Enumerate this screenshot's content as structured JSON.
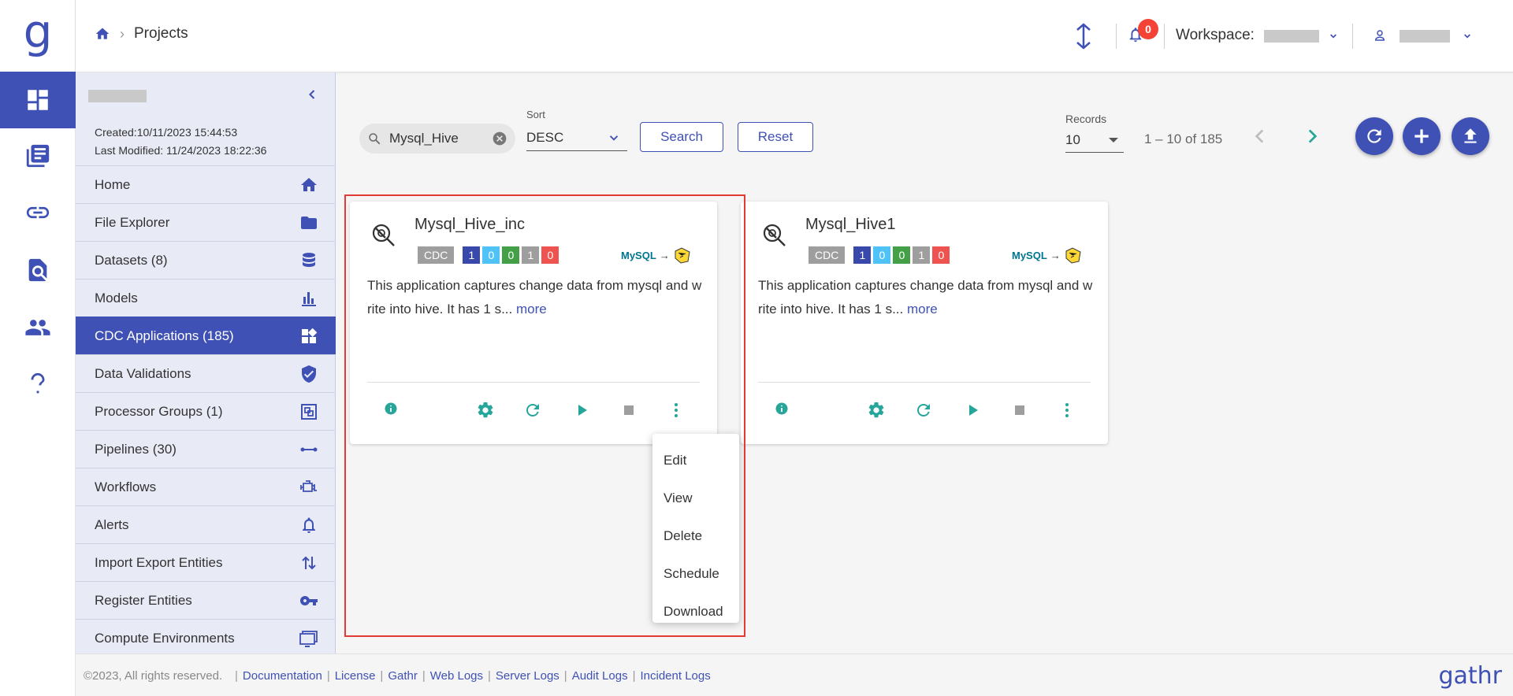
{
  "app": {
    "logo_letter": "g",
    "brand": "gathr"
  },
  "breadcrumb": {
    "current": "Projects"
  },
  "header": {
    "notification_count": "0",
    "workspace_label": "Workspace:"
  },
  "panel": {
    "created": "Created:10/11/2023 15:44:53",
    "modified": "Last Modified: 11/24/2023 18:22:36",
    "menu": [
      {
        "label": "Home",
        "icon": "home-icon"
      },
      {
        "label": "File Explorer",
        "icon": "folder-icon"
      },
      {
        "label": "Datasets  (8)",
        "icon": "database-icon"
      },
      {
        "label": "Models",
        "icon": "bar-chart-icon"
      },
      {
        "label": "CDC Applications  (185)",
        "icon": "widgets-icon"
      },
      {
        "label": "Data Validations",
        "icon": "shield-check-icon"
      },
      {
        "label": "Processor Groups  (1)",
        "icon": "group-icon"
      },
      {
        "label": "Pipelines  (30)",
        "icon": "pipeline-icon"
      },
      {
        "label": "Workflows",
        "icon": "workflow-icon"
      },
      {
        "label": "Alerts",
        "icon": "bell-icon"
      },
      {
        "label": "Import Export Entities",
        "icon": "import-export-icon"
      },
      {
        "label": "Register Entities",
        "icon": "key-icon"
      },
      {
        "label": "Compute Environments",
        "icon": "monitor-icon"
      }
    ]
  },
  "toolbar": {
    "search_value": "Mysql_Hive",
    "sort_label": "Sort",
    "sort_value": "DESC",
    "search_button": "Search",
    "reset_button": "Reset",
    "records_label": "Records",
    "records_value": "10",
    "range": "1 – 10 of 185"
  },
  "cards": [
    {
      "title": "Mysql_Hive_inc",
      "type_tag": "CDC",
      "counts": [
        "1",
        "0",
        "0",
        "1",
        "0"
      ],
      "source": "MySQL",
      "description": "This application captures change data from mysql and write into hive. It has 1 s...",
      "more": "more"
    },
    {
      "title": "Mysql_Hive1",
      "type_tag": "CDC",
      "counts": [
        "1",
        "0",
        "0",
        "1",
        "0"
      ],
      "source": "MySQL",
      "description": "This application captures change data from mysql and write into hive. It has 1 s...",
      "more": "more"
    }
  ],
  "count_colors": [
    "#3949ab",
    "#4fc3f7",
    "#43a047",
    "#9e9e9e",
    "#ef5350"
  ],
  "dropdown": [
    "Edit",
    "View",
    "Delete",
    "Schedule",
    "Download"
  ],
  "footer": {
    "copyright": "©2023, All rights reserved.",
    "links": [
      "Documentation",
      "License",
      "Gathr",
      "Web Logs",
      "Server Logs",
      "Audit Logs",
      "Incident Logs"
    ]
  },
  "colors": {
    "primary": "#3f51b5",
    "accent": "#26a69a",
    "highlight": "#e53935"
  }
}
